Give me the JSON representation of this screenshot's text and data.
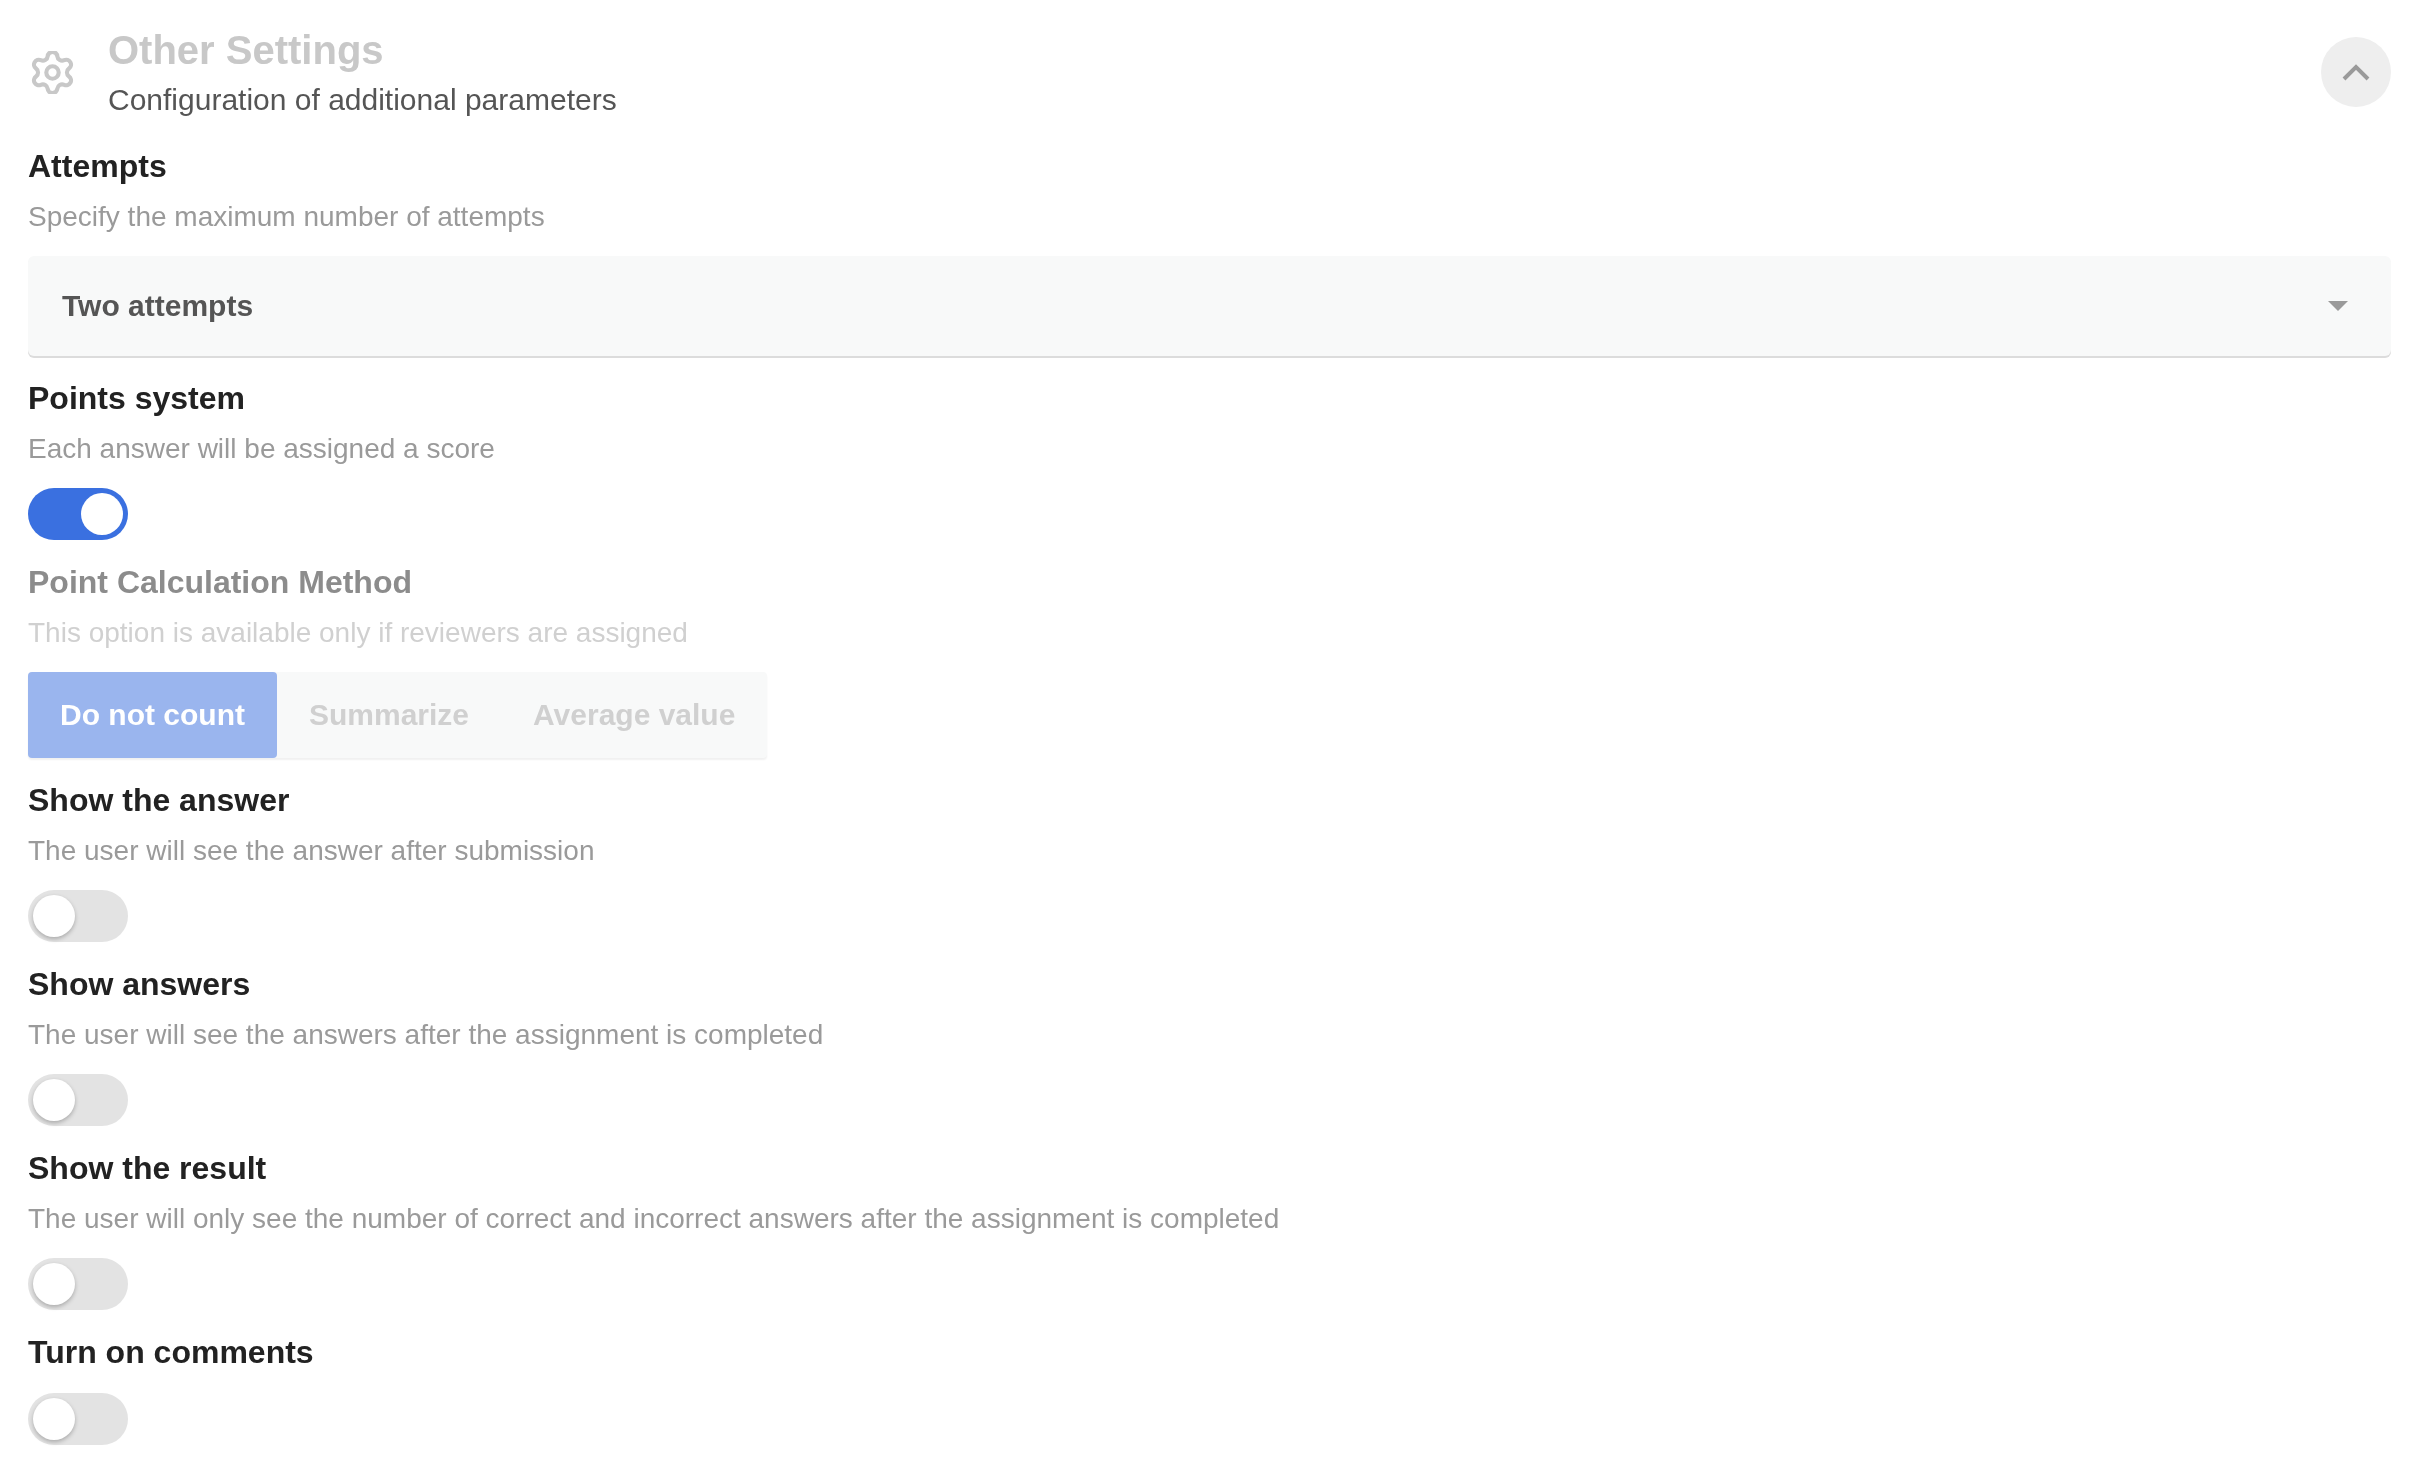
{
  "header": {
    "title": "Other Settings",
    "subtitle": "Configuration of additional parameters",
    "expanded": true
  },
  "settings": [
    {
      "kind": "select",
      "label": "Attempts",
      "description": "Specify the maximum number of attempts",
      "disabled": false,
      "value": "Two attempts"
    },
    {
      "kind": "toggle",
      "label": "Points system",
      "description": "Each answer will be assigned a score",
      "disabled": false,
      "on": true
    },
    {
      "kind": "segmented",
      "label": "Point Calculation Method",
      "description": "This option is available only if reviewers are assigned",
      "disabled": true,
      "options": [
        {
          "label": "Do not count",
          "selected": true
        },
        {
          "label": "Summarize",
          "selected": false
        },
        {
          "label": "Average value",
          "selected": false
        }
      ]
    },
    {
      "kind": "toggle",
      "label": "Show the answer",
      "description": "The user will see the answer after submission",
      "disabled": false,
      "on": false
    },
    {
      "kind": "toggle",
      "label": "Show answers",
      "description": "The user will see the answers after the assignment is completed",
      "disabled": false,
      "on": false
    },
    {
      "kind": "toggle",
      "label": "Show the result",
      "description": "The user will only see the number of correct and incorrect answers after the assignment is completed",
      "disabled": false,
      "on": false
    },
    {
      "kind": "toggle",
      "label": "Turn on comments",
      "disabled": false,
      "on": false
    }
  ]
}
